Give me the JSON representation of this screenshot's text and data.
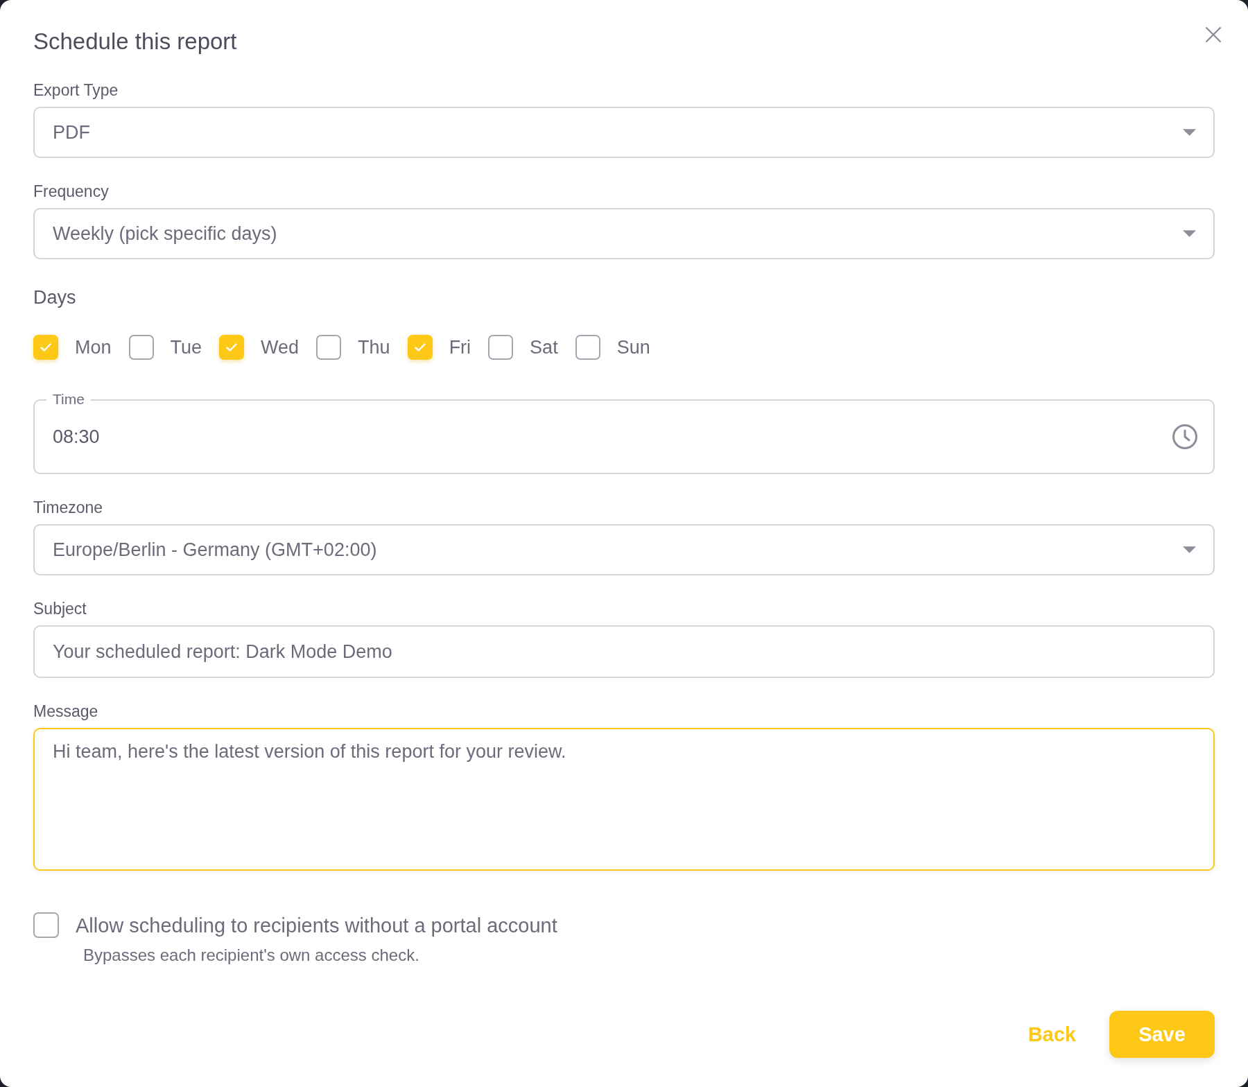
{
  "dialog": {
    "title": "Schedule this report"
  },
  "fields": [
    {
      "kind": "select",
      "label": "Export Type",
      "value": "PDF",
      "focused": false
    },
    {
      "kind": "select",
      "label": "Frequency",
      "value": "Weekly (pick specific days)",
      "focused": false
    },
    {
      "kind": "checkbox_group",
      "label": "Days",
      "items": [
        {
          "label": "Mon",
          "checked": true
        },
        {
          "label": "Tue",
          "checked": false
        },
        {
          "label": "Wed",
          "checked": true
        },
        {
          "label": "Thu",
          "checked": false
        },
        {
          "label": "Fri",
          "checked": true
        },
        {
          "label": "Sat",
          "checked": false
        },
        {
          "label": "Sun",
          "checked": false
        }
      ]
    },
    {
      "kind": "time",
      "label": "Time",
      "value": "08:30",
      "focused": false
    },
    {
      "kind": "select",
      "label": "Timezone",
      "value": "Europe/Berlin - Germany (GMT+02:00)",
      "focused": false
    },
    {
      "kind": "text",
      "label": "Subject",
      "value": "Your scheduled report: Dark Mode Demo",
      "focused": false
    },
    {
      "kind": "textarea",
      "label": "Message",
      "value": "Hi team, here's the latest version of this report for your review.",
      "focused": true
    }
  ],
  "allow_option": {
    "label": "Allow scheduling to recipients without a portal account",
    "checked": false,
    "hint": "Bypasses each recipient's own access check."
  },
  "buttons": [
    {
      "label": "Back",
      "kind": "text"
    },
    {
      "label": "Save",
      "kind": "primary"
    }
  ]
}
